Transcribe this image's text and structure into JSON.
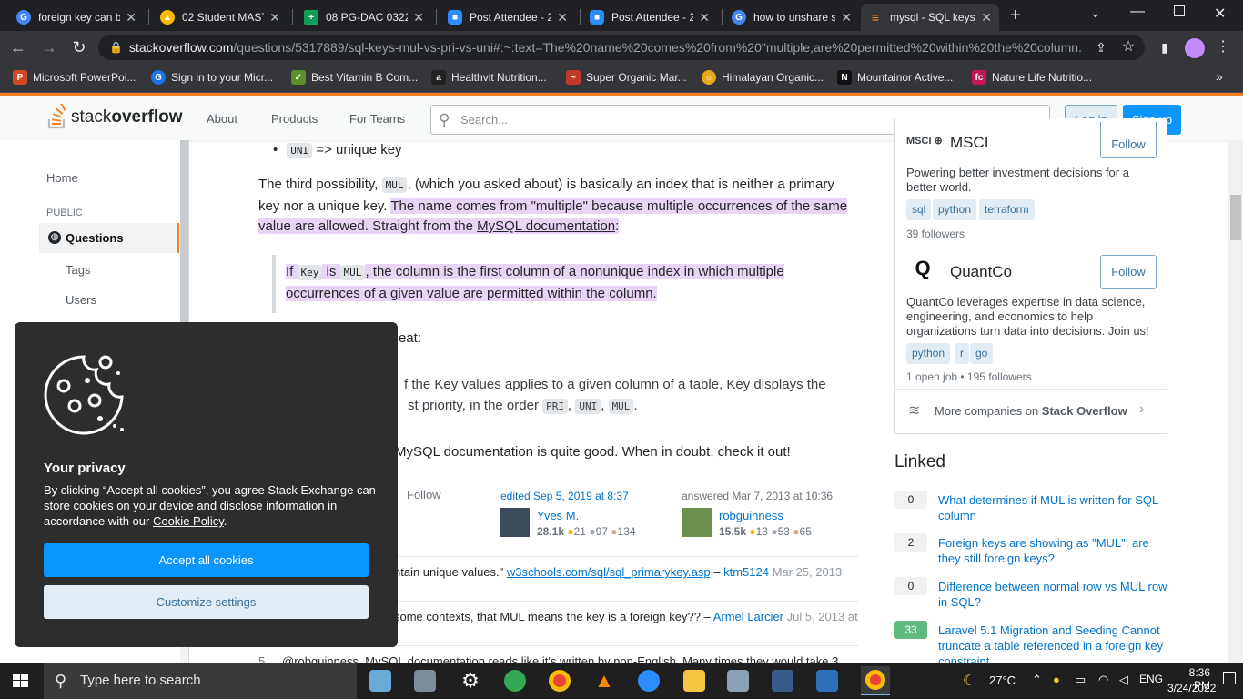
{
  "browser": {
    "tabs": [
      {
        "title": "foreign key can b",
        "icon": "google-icon",
        "color": "#4285f4"
      },
      {
        "title": "02 Student MAST",
        "icon": "drive-icon",
        "color": "#fbbc04"
      },
      {
        "title": "08 PG-DAC 0322",
        "icon": "sheets-icon",
        "color": "#0f9d58"
      },
      {
        "title": "Post Attendee - 2",
        "icon": "zoom-icon",
        "color": "#2d8cff"
      },
      {
        "title": "Post Attendee - 2",
        "icon": "zoom-icon",
        "color": "#2d8cff"
      },
      {
        "title": "how to unshare s",
        "icon": "google-icon",
        "color": "#4285f4"
      },
      {
        "title": "mysql - SQL keys",
        "icon": "stackoverflow-icon",
        "color": "#f48225"
      }
    ],
    "url_host": "stackoverflow.com",
    "url_path": "/questions/5317889/sql-keys-mul-vs-pri-vs-uni#:~:text=The%20name%20comes%20from%20\"multiple,are%20permitted%20within%20the%20column.",
    "bookmarks": [
      {
        "label": "Microsoft PowerPoi...",
        "color": "#d24726"
      },
      {
        "label": "Sign in to your Micr...",
        "color": "#1a73e8"
      },
      {
        "label": "Best Vitamin B Com...",
        "color": "#5a8f29"
      },
      {
        "label": "Healthvit Nutrition...",
        "color": "#222222"
      },
      {
        "label": "Super Organic Mar...",
        "color": "#c0392b"
      },
      {
        "label": "Himalayan Organic...",
        "color": "#e6a817"
      },
      {
        "label": "Mountainor Active...",
        "color": "#111111"
      },
      {
        "label": "Nature Life Nutritio...",
        "color": "#c2185b"
      }
    ]
  },
  "header": {
    "logo_stack": "stack",
    "logo_overflow": "overflow",
    "nav": [
      "About",
      "Products",
      "For Teams"
    ],
    "search_placeholder": "Search...",
    "login": "Log in",
    "signup": "Sign up"
  },
  "leftnav": {
    "home": "Home",
    "public": "PUBLIC",
    "questions": "Questions",
    "tags": "Tags",
    "users": "Users"
  },
  "answer": {
    "uni_line_code": "UNI",
    "uni_line_text": "=> unique key",
    "p1_a": "The third possibility, ",
    "p1_code": "MUL",
    "p1_b": ", (which you asked about) is basically an index that is neither a primary key nor a unique key. ",
    "p1_hl1": "The name comes from \"multiple\" because multiple occurrences of the same value are allowed. Straight from the ",
    "p1_link": "MySQL documentation",
    "p1_hl2": ":",
    "q_a": "If ",
    "q_code1": "Key",
    "q_b": " is ",
    "q_code2": "MUL",
    "q_c": ", the column is the first column of a nonunique index in which multiple occurrences of a given value are permitted within the column.",
    "p2": "eat:",
    "p3_a": "f the Key values applies to a given column of a table, Key displays the",
    "p3_b": "st priority, in the order ",
    "p3_c1": "PRI",
    "p3_c2": "UNI",
    "p3_c3": "MUL",
    "p4": "MySQL documentation is quite good. When in doubt, check it out!",
    "follow": "Follow",
    "edited": "edited Sep 5, 2019 at 8:37",
    "editor": {
      "name": "Yves M.",
      "rep": "28.1k",
      "gold": "21",
      "silver": "97",
      "bronze": "134"
    },
    "answered": "answered Mar 7, 2013 at 10:36",
    "author": {
      "name": "robguinness",
      "rep": "15.5k",
      "gold": "13",
      "silver": "53",
      "bronze": "65"
    },
    "comments": [
      {
        "text": "ntain unique values.\" ",
        "link": "w3schools.com/sql/sql_primarykey.asp",
        "user": "ktm5124",
        "date": "Mar 25, 2013"
      },
      {
        "text": "some contexts, that MUL means the key is a foreign key?? – ",
        "user": "Armel Larcier",
        "date": "Jul 5, 2013 at"
      },
      {
        "score": "5",
        "text": "@robguinness, MySQL documentation reads like it's written by non-English. Many times they would take 3"
      }
    ]
  },
  "sidebar": {
    "companies": [
      {
        "name": "MSCI",
        "desc": "Powering better investment decisions for a better world.",
        "tags": [
          "sql",
          "python",
          "terraform"
        ],
        "foot": "39 followers",
        "follow": "Follow"
      },
      {
        "name": "QuantCo",
        "desc": "QuantCo leverages expertise in data science, engineering, and economics to help organizations turn data into decisions. Join us!",
        "tags": [
          "python",
          "r",
          "go"
        ],
        "foot": "1 open job • 195 followers",
        "follow": "Follow"
      }
    ],
    "more_companies_a": "More companies on ",
    "more_companies_b": "Stack Overflow",
    "linked_heading": "Linked",
    "linked": [
      {
        "count": "0",
        "title": "What determines if MUL is written for SQL column",
        "answered": false
      },
      {
        "count": "2",
        "title": "Foreign keys are showing as \"MUL\"; are they still foreign keys?",
        "answered": false
      },
      {
        "count": "0",
        "title": "Difference between normal row vs MUL row in SQL?",
        "answered": false
      },
      {
        "count": "33",
        "title": "Laravel 5.1 Migration and Seeding Cannot truncate a table referenced in a foreign key constraint",
        "answered": true
      }
    ]
  },
  "cookie": {
    "title": "Your privacy",
    "text_a": "By clicking “Accept all cookies”, you agree Stack Exchange can store cookies on your device and disclose information in accordance with our ",
    "policy": "Cookie Policy",
    "text_b": ".",
    "accept": "Accept all cookies",
    "customize": "Customize settings"
  },
  "taskbar": {
    "search": "Type here to search",
    "temp": "27°C",
    "time": "8:36 PM",
    "date": "3/24/2022"
  }
}
